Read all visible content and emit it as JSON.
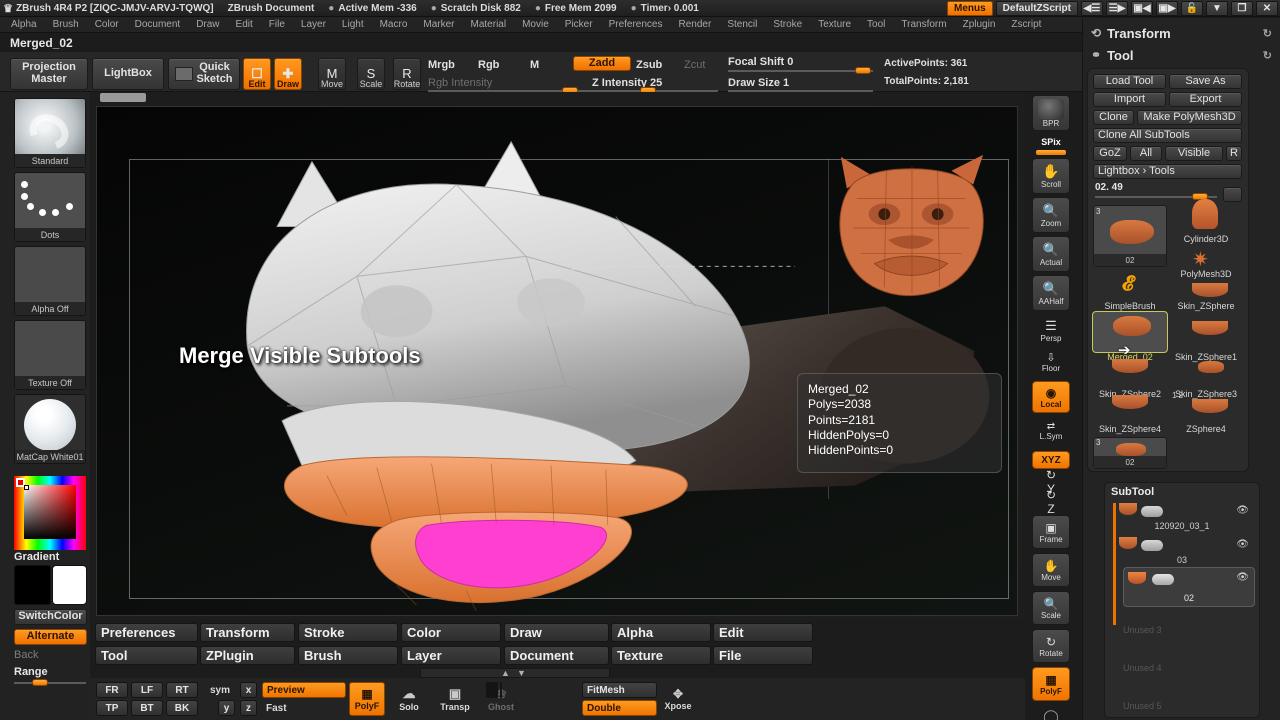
{
  "titlebar": {
    "logo_icon": "zbrush-logo-icon",
    "app_title": "ZBrush 4R4 P2 [ZIQC-JMJV-ARVJ-TQWQ]",
    "document_title": "ZBrush Document",
    "active_mem": "Active Mem -336",
    "scratch_disk": "Scratch Disk 882",
    "free_mem": "Free Mem 2099",
    "timer": "Timer› 0.001",
    "menus_button": "Menus",
    "zscript_name": "DefaultZScript",
    "zscript_prev_icon": "zscript-prev-icon",
    "zscript_next_icon": "zscript-next-icon",
    "window_cascade_icon": "window-cascade-icon",
    "window_tile_icon": "window-tile-icon",
    "lock_icon": "lock-icon",
    "minimize_icon": "minimize-icon",
    "restore_icon": "restore-icon",
    "close_icon": "close-icon"
  },
  "menustrip": {
    "items": [
      "Alpha",
      "Brush",
      "Color",
      "Document",
      "Draw",
      "Edit",
      "File",
      "Layer",
      "Light",
      "Macro",
      "Marker",
      "Material",
      "Movie",
      "Picker",
      "Preferences",
      "Render",
      "Stencil",
      "Stroke",
      "Texture",
      "Tool",
      "Transform",
      "Zplugin",
      "Zscript"
    ]
  },
  "document": {
    "name": "Merged_02"
  },
  "shelf": {
    "projection_master": "Projection\nMaster",
    "lightbox": "LightBox",
    "quick_sketch": "Quick\nSketch",
    "edit": "Edit",
    "draw": "Draw",
    "move": "Move",
    "scale": "Scale",
    "rotate": "Rotate",
    "mrgb": "Mrgb",
    "rgb": "Rgb",
    "m": "M",
    "zadd": "Zadd",
    "zsub": "Zsub",
    "zcut": "Zcut",
    "rgb_intensity": "Rgb Intensity",
    "z_intensity": "Z Intensity 25",
    "focal_shift": "Focal Shift 0",
    "draw_size": "Draw Size 1",
    "active_points": "ActivePoints: 361",
    "total_points": "TotalPoints: 2,181"
  },
  "left_palette": {
    "brush": {
      "label": "Standard",
      "icon": "brush-standard-icon"
    },
    "stroke": {
      "label": "Dots",
      "icon": "stroke-dots-icon"
    },
    "alpha": {
      "label": "Alpha Off",
      "icon": "alpha-off-icon"
    },
    "texture": {
      "label": "Texture Off",
      "icon": "texture-off-icon"
    },
    "material": {
      "label": "MatCap White01",
      "icon": "material-sphere-icon"
    },
    "gradient_label": "Gradient",
    "switch_color": "SwitchColor",
    "alternate": "Alternate",
    "back": "Back",
    "range": "Range",
    "main_color": "#000000",
    "secondary_color": "#ffffff",
    "accent": "#f07000"
  },
  "canvas": {
    "overlay_title": "Merge Visible Subtools",
    "info": {
      "name": "Merged_02",
      "polys": "Polys=2038",
      "points": "Points=2181",
      "hidden_polys": "HiddenPolys=0",
      "hidden_points": "HiddenPoints=0"
    }
  },
  "right_toolbar": {
    "bpr": "BPR",
    "spix": "SPix",
    "scroll": "Scroll",
    "zoom": "Zoom",
    "actual": "Actual",
    "aahalf": "AAHalf",
    "persp": "Persp",
    "floor": "Floor",
    "local": "Local",
    "lsym": "L.Sym",
    "xyz": "XYZ",
    "y_axis": "Y",
    "z_axis": "Z",
    "frame": "Frame",
    "move": "Move",
    "scale": "Scale",
    "rotate": "Rotate",
    "polyf": "PolyF"
  },
  "transform_palette": {
    "title": "Transform",
    "icon": "transform-icon",
    "refresh_icon": "refresh-icon"
  },
  "tool_palette": {
    "title": "Tool",
    "icon": "tool-icon",
    "refresh_icon": "refresh-icon",
    "buttons": {
      "load_tool": "Load Tool",
      "save_as": "Save As",
      "import": "Import",
      "export": "Export",
      "clone": "Clone",
      "make_polymesh3d": "Make PolyMesh3D",
      "clone_all_subtools": "Clone All SubTools",
      "goz": "GoZ",
      "all": "All",
      "visible": "Visible",
      "r": "R",
      "lightbox_tools": "Lightbox › Tools"
    },
    "slider": {
      "value": "02. 49",
      "reset": "R"
    },
    "items": [
      {
        "label": "02",
        "badge": "3",
        "icon": "tool-thumb-mesh-icon",
        "selected": false,
        "kind": "thumb"
      },
      {
        "label": "Cylinder3D",
        "icon": "cylinder3d-icon",
        "selected": false,
        "kind": "name"
      },
      {
        "label": "PolyMesh3D",
        "icon": "polymesh3d-icon",
        "selected": false,
        "kind": "name"
      },
      {
        "label": "SimpleBrush",
        "icon": "simplebrush-icon",
        "selected": false,
        "kind": "name"
      },
      {
        "label": "Skin_ZSphere",
        "icon": "skin-zsphere-icon",
        "selected": false,
        "kind": "name"
      },
      {
        "label": "Merged_02",
        "icon": "merged-02-icon",
        "selected": true,
        "kind": "name"
      },
      {
        "label": "Skin_ZSphere1",
        "icon": "skin-zsphere1-icon",
        "selected": false,
        "kind": "name"
      },
      {
        "label": "Skin_ZSphere2",
        "icon": "skin-zsphere2-icon",
        "selected": false,
        "kind": "name"
      },
      {
        "label": "Skin_ZSphere3",
        "icon": "skin-zsphere3-icon",
        "selected": false,
        "kind": "name"
      },
      {
        "label": "Skin_ZSphere4",
        "icon": "skin-zsphere4-icon",
        "selected": false,
        "kind": "name"
      },
      {
        "label": "ZSphere4",
        "icon": "zsphere4-icon",
        "selected": false,
        "kind": "name"
      },
      {
        "label": "02",
        "badge": "3",
        "icon": "tool-thumb-mesh2-icon",
        "selected": false,
        "kind": "thumb"
      }
    ],
    "sub_badge_12": "1 2",
    "sub_badge_3": "3",
    "cursor_icon": "mouse-cursor-icon"
  },
  "subtool_palette": {
    "title": "SubTool",
    "rows": [
      {
        "name": "120920_03_1",
        "selected": false,
        "eye_icon": "eye-icon",
        "thumb_icon": "subtool-thumb-icon"
      },
      {
        "name": "03",
        "selected": false,
        "eye_icon": "eye-icon",
        "thumb_icon": "subtool-thumb-icon"
      },
      {
        "name": "02",
        "selected": true,
        "eye_icon": "eye-icon",
        "thumb_icon": "subtool-thumb-icon"
      }
    ],
    "unused": [
      "Unused 3",
      "Unused 4",
      "Unused 5"
    ]
  },
  "bottom_menus": {
    "row1": [
      "Preferences",
      "Transform",
      "Stroke",
      "Color",
      "Draw",
      "Alpha",
      "Edit"
    ],
    "row2": [
      "Tool",
      "ZPlugin",
      "Brush",
      "Layer",
      "Document",
      "Texture",
      "File"
    ],
    "scroll_up_icon": "scroll-up-icon",
    "scroll_down_icon": "scroll-down-icon"
  },
  "bottom_bar": {
    "fr": "FR",
    "lf": "LF",
    "rt": "RT",
    "sym": "sym",
    "x": "x",
    "tp": "TP",
    "bt": "BT",
    "bk": "BK",
    "y": "y",
    "z": "z",
    "preview": "Preview",
    "fast": "Fast",
    "polyf": "PolyF",
    "solo": "Solo",
    "transp": "Transp",
    "ghost": "Ghost",
    "fitmesh": "FitMesh",
    "double": "Double",
    "xpose": "Xpose"
  }
}
